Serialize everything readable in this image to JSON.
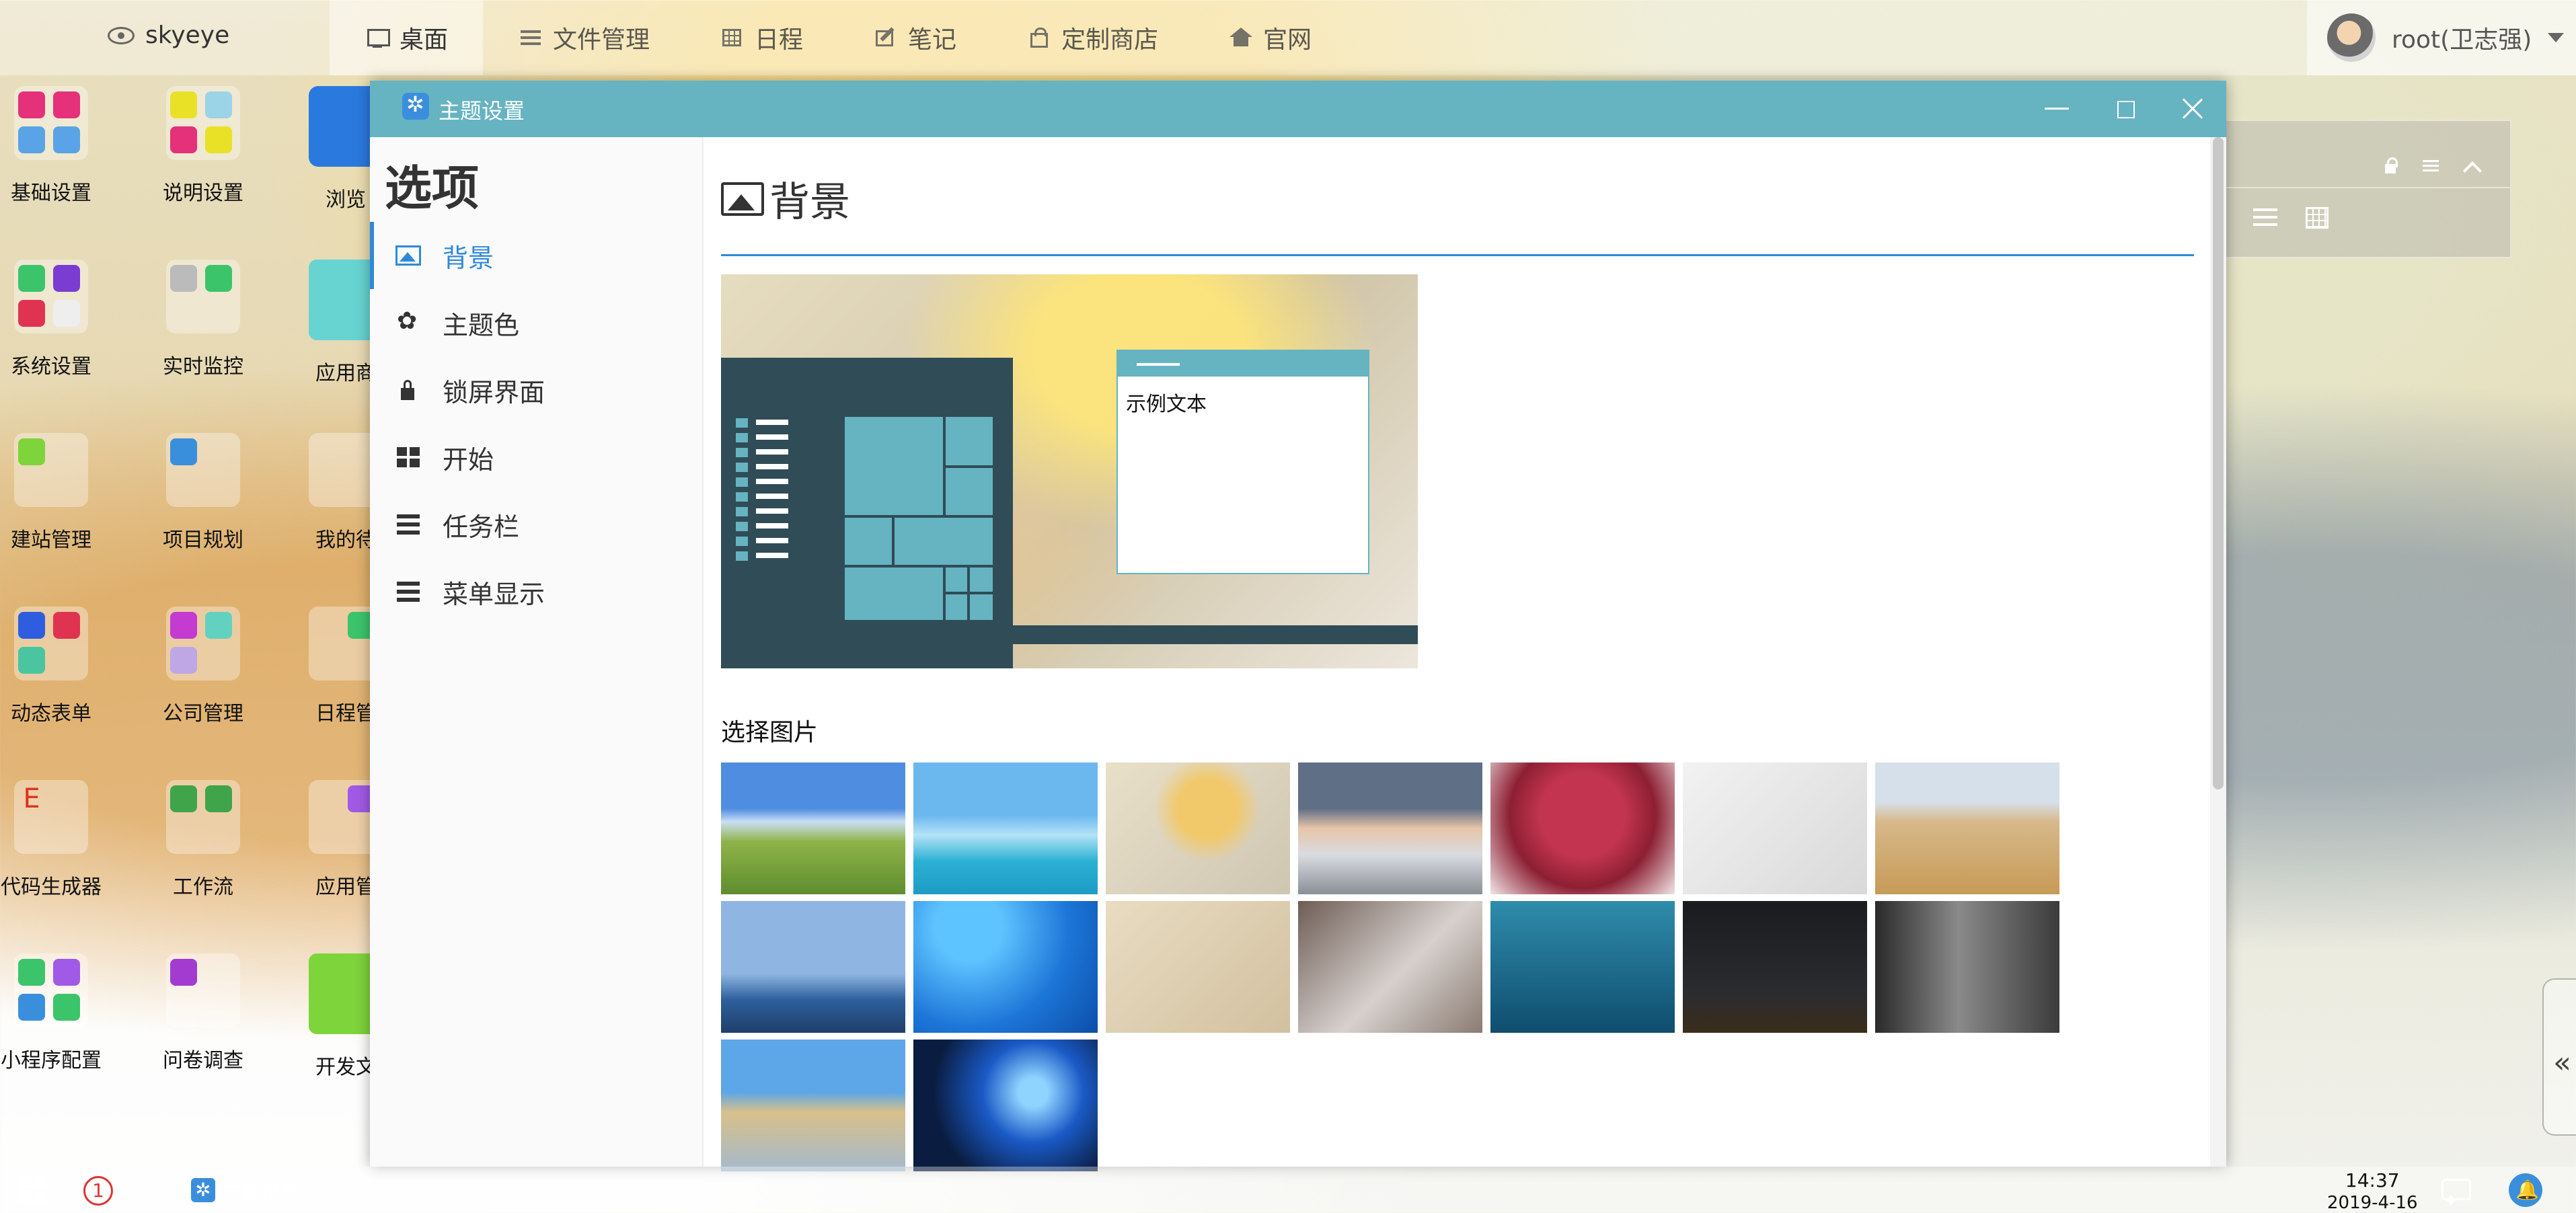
{
  "topbar": {
    "brand": "skyeye",
    "nav": [
      {
        "label": "桌面",
        "icon": "monitor-icon",
        "active": true
      },
      {
        "label": "文件管理",
        "icon": "file-list-icon",
        "active": false
      },
      {
        "label": "日程",
        "icon": "calendar-icon",
        "active": false
      },
      {
        "label": "笔记",
        "icon": "edit-icon",
        "active": false
      },
      {
        "label": "定制商店",
        "icon": "shopping-bag-icon",
        "active": false
      },
      {
        "label": "官网",
        "icon": "home-icon",
        "active": false
      }
    ],
    "user": {
      "name": "root(卫志强)"
    }
  },
  "desktop": {
    "col1": [
      "基础设置",
      "系统设置",
      "建站管理",
      "动态表单",
      "代码生成器",
      "小程序配置"
    ],
    "col2": [
      "说明设置",
      "实时监控",
      "项目规划",
      "公司管理",
      "工作流",
      "问卷调查"
    ],
    "col3": [
      "浏览",
      "应用商",
      "我的待",
      "日程管",
      "应用管",
      "开发文"
    ]
  },
  "window": {
    "title": "主题设置",
    "options_title": "选项",
    "options": [
      {
        "label": "背景",
        "icon": "image-icon",
        "active": true
      },
      {
        "label": "主题色",
        "icon": "paw-icon",
        "active": false
      },
      {
        "label": "锁屏界面",
        "icon": "lock-icon",
        "active": false
      },
      {
        "label": "开始",
        "icon": "windows-icon",
        "active": false
      },
      {
        "label": "任务栏",
        "icon": "taskbar-icon",
        "active": false
      },
      {
        "label": "菜单显示",
        "icon": "menu-display-icon",
        "active": false
      }
    ],
    "section_title": "背景",
    "preview_text": "示例文本",
    "choose_label": "选择图片",
    "thumbnails": [
      {
        "name": "grassland-lake"
      },
      {
        "name": "tropical-island"
      },
      {
        "name": "autumn-cup"
      },
      {
        "name": "snowy-bridge"
      },
      {
        "name": "plum-blossom-tree"
      },
      {
        "name": "ink-plum-birds"
      },
      {
        "name": "wheat-field"
      },
      {
        "name": "sailing-ship"
      },
      {
        "name": "blue-swirl"
      },
      {
        "name": "chinese-painting"
      },
      {
        "name": "portrait-bedroom"
      },
      {
        "name": "underwater-swimmer"
      },
      {
        "name": "milky-way-tent"
      },
      {
        "name": "grey-waterfall"
      },
      {
        "name": "beach-rocks"
      },
      {
        "name": "windows-logo-light"
      }
    ]
  },
  "taskbar": {
    "badge": "1",
    "app_label": "主题设置",
    "time": "14:37",
    "date": "2019-4-16"
  },
  "colors": {
    "accent": "#2e89d9",
    "window_title": "#66b3c2",
    "preview_dark": "#2f4c57"
  }
}
